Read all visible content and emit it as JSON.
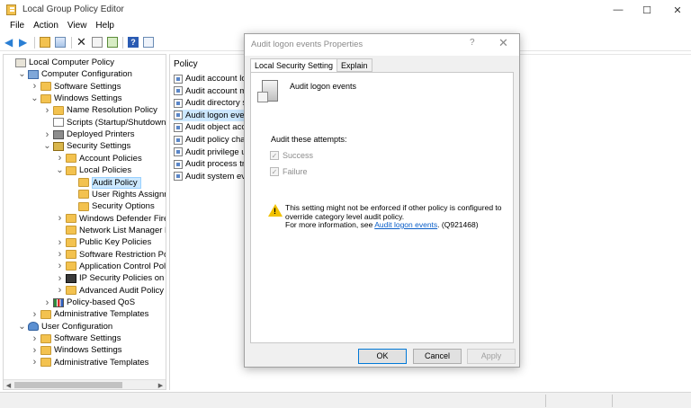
{
  "window": {
    "title": "Local Group Policy Editor",
    "minimize": "—",
    "maximize": "☐",
    "close": "✕"
  },
  "menu": [
    "File",
    "Action",
    "View",
    "Help"
  ],
  "tree": {
    "items": [
      {
        "label": "Local Computer Policy",
        "icon": "policy-icon",
        "level": 0,
        "chevron": ""
      },
      {
        "label": "Computer Configuration",
        "icon": "computer-icon",
        "level": 1,
        "chevron": "open"
      },
      {
        "label": "Software Settings",
        "icon": "folder-icon",
        "level": 2,
        "chevron": "closed"
      },
      {
        "label": "Windows Settings",
        "icon": "folder-icon",
        "level": 2,
        "chevron": "open"
      },
      {
        "label": "Name Resolution Policy",
        "icon": "folder-icon",
        "level": 3,
        "chevron": "closed"
      },
      {
        "label": "Scripts (Startup/Shutdown)",
        "icon": "document-icon",
        "level": 3,
        "chevron": ""
      },
      {
        "label": "Deployed Printers",
        "icon": "printer-icon",
        "level": 3,
        "chevron": "closed"
      },
      {
        "label": "Security Settings",
        "icon": "security-icon",
        "level": 3,
        "chevron": "open"
      },
      {
        "label": "Account Policies",
        "icon": "folder-icon",
        "level": 4,
        "chevron": "closed"
      },
      {
        "label": "Local Policies",
        "icon": "folder-icon",
        "level": 4,
        "chevron": "open"
      },
      {
        "label": "Audit Policy",
        "icon": "folder-icon",
        "level": 5,
        "chevron": "",
        "selected": true
      },
      {
        "label": "User Rights Assignment",
        "icon": "folder-icon",
        "level": 5,
        "chevron": ""
      },
      {
        "label": "Security Options",
        "icon": "folder-icon",
        "level": 5,
        "chevron": ""
      },
      {
        "label": "Windows Defender Firewall",
        "icon": "folder-icon",
        "level": 4,
        "chevron": "closed"
      },
      {
        "label": "Network List Manager Polic",
        "icon": "folder-icon",
        "level": 4,
        "chevron": ""
      },
      {
        "label": "Public Key Policies",
        "icon": "folder-icon",
        "level": 4,
        "chevron": "closed"
      },
      {
        "label": "Software Restriction Policie",
        "icon": "folder-icon",
        "level": 4,
        "chevron": "closed"
      },
      {
        "label": "Application Control Policies",
        "icon": "folder-icon",
        "level": 4,
        "chevron": "closed"
      },
      {
        "label": "IP Security Policies on Loca",
        "icon": "ip-security-icon",
        "level": 4,
        "chevron": "closed"
      },
      {
        "label": "Advanced Audit Policy Con",
        "icon": "folder-icon",
        "level": 4,
        "chevron": "closed"
      },
      {
        "label": "Policy-based QoS",
        "icon": "chart-icon",
        "level": 3,
        "chevron": "closed"
      },
      {
        "label": "Administrative Templates",
        "icon": "folder-icon",
        "level": 2,
        "chevron": "closed"
      },
      {
        "label": "User Configuration",
        "icon": "user-icon",
        "level": 1,
        "chevron": "open"
      },
      {
        "label": "Software Settings",
        "icon": "folder-icon",
        "level": 2,
        "chevron": "closed"
      },
      {
        "label": "Windows Settings",
        "icon": "folder-icon",
        "level": 2,
        "chevron": "closed"
      },
      {
        "label": "Administrative Templates",
        "icon": "folder-icon",
        "level": 2,
        "chevron": "closed"
      }
    ]
  },
  "list": {
    "header": "Policy",
    "rows": [
      {
        "label": "Audit account lo",
        "selected": false
      },
      {
        "label": "Audit account m",
        "selected": false
      },
      {
        "label": "Audit directory s",
        "selected": false
      },
      {
        "label": "Audit logon even",
        "selected": true
      },
      {
        "label": "Audit object acc",
        "selected": false
      },
      {
        "label": "Audit policy char",
        "selected": false
      },
      {
        "label": "Audit privilege u",
        "selected": false
      },
      {
        "label": "Audit process tra",
        "selected": false
      },
      {
        "label": "Audit system eve",
        "selected": false
      }
    ]
  },
  "dialog": {
    "title": "Audit logon events Properties",
    "help": "?",
    "close": "✕",
    "tabs": [
      {
        "label": "Local Security Setting",
        "active": true
      },
      {
        "label": "Explain",
        "active": false
      }
    ],
    "policy_name": "Audit logon events",
    "audit_label": "Audit these attempts:",
    "options": [
      {
        "label": "Success",
        "checked": true
      },
      {
        "label": "Failure",
        "checked": true
      }
    ],
    "warning_line1": "This setting might not be enforced if other policy is configured to",
    "warning_line2": "override category level audit policy.",
    "warning_line3_prefix": "For more information, see ",
    "warning_link": "Audit logon events",
    "warning_line3_suffix": ". (Q921468)",
    "buttons": {
      "ok": "OK",
      "cancel": "Cancel",
      "apply": "Apply"
    }
  }
}
